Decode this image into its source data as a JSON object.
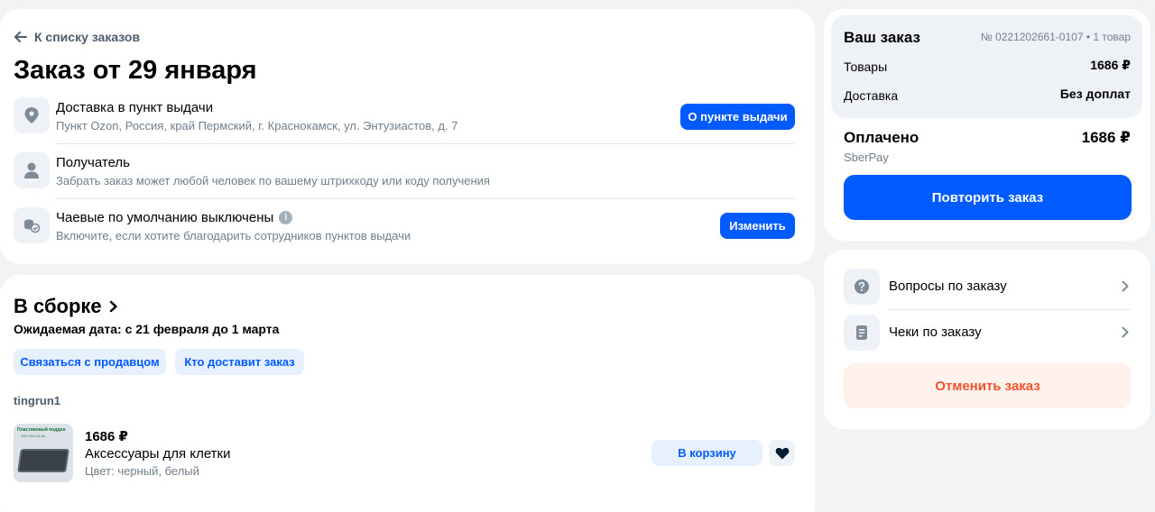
{
  "header": {
    "back_link": "К списку заказов",
    "title": "Заказ от 29 января"
  },
  "info_rows": [
    {
      "title": "Доставка в пункт выдачи",
      "subtitle": "Пункт Ozon, Россия, край Пермский, г. Краснокамск, ул. Энтузиастов, д. 7",
      "button": "О пункте выдачи",
      "icon": "location-pin-icon"
    },
    {
      "title": "Получатель",
      "subtitle": "Забрать заказ может любой человек по вашему штрихкоду или коду получения",
      "icon": "user-icon"
    },
    {
      "title": "Чаевые по умолчанию выключены",
      "subtitle": "Включите, если хотите благодарить сотрудников пунктов выдачи",
      "button": "Изменить",
      "icon": "coins-icon"
    }
  ],
  "shipment": {
    "status": "В сборке",
    "expected": "Ожидаемая дата: с 21 февраля до 1 марта",
    "contact_seller": "Связаться с продавцом",
    "who_delivers": "Кто доставит заказ",
    "seller": "tingrun1",
    "product": {
      "price": "1686 ₽",
      "name": "Аксессуары для клетки",
      "color": "Цвет: черный, белый",
      "cart_button": "В корзину",
      "thumb_text": "Пластиковый поддон",
      "thumb_size": "119×73×3.5 см"
    }
  },
  "summary": {
    "title": "Ваш заказ",
    "order_meta": "№ 0221202661-0107 • 1 товар",
    "goods_label": "Товары",
    "goods_value": "1686 ₽",
    "delivery_label": "Доставка",
    "delivery_value": "Без доплат",
    "paid_label": "Оплачено",
    "paid_value": "1686 ₽",
    "payment_method": "SberPay",
    "repeat_button": "Повторить заказ"
  },
  "links": {
    "questions": "Вопросы по заказу",
    "receipts": "Чеки по заказу",
    "cancel": "Отменить заказ"
  },
  "colors": {
    "accent": "#005bff",
    "cancel_text": "#f1532b",
    "cancel_bg": "#fff1ec",
    "page_bg": "#f2f3f5"
  }
}
